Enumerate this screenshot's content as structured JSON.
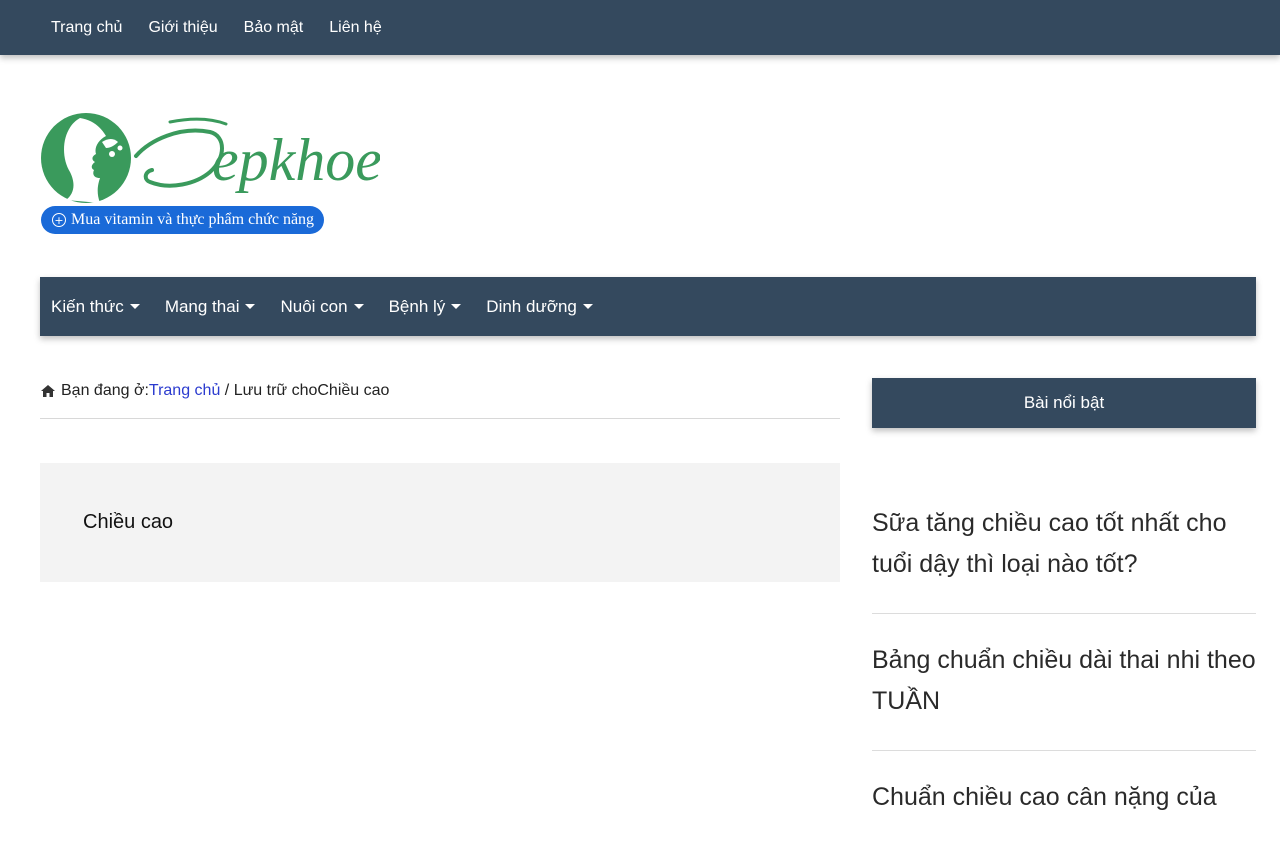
{
  "topnav": {
    "items": [
      "Trang chủ",
      "Giới thiệu",
      "Bảo mật",
      "Liên hệ"
    ]
  },
  "logo": {
    "text": "Đẹpkhoe",
    "buy_button_label": "Mua vitamin và thực phẩm chức năng",
    "brand_color": "#3a9a5c"
  },
  "mainnav": {
    "items": [
      "Kiến thức",
      "Mang thai",
      "Nuôi con",
      "Bệnh lý",
      "Dinh dưỡng"
    ]
  },
  "breadcrumb": {
    "prefix": "Bạn đang ở:",
    "home_link": "Trang chủ",
    "separator": " / ",
    "current": "Lưu trữ choChiều cao"
  },
  "archive": {
    "title": "Chiều cao"
  },
  "sidebar": {
    "title": "Bài nổi bật",
    "posts": [
      "Sữa tăng chiều cao tốt nhất cho tuổi dậy thì loại nào tốt?",
      "Bảng chuẩn chiều dài thai nhi theo TUẦN",
      "Chuẩn chiều cao cân nặng của"
    ]
  },
  "colors": {
    "nav_bg": "#34495e",
    "link": "#2b3bcf",
    "button_blue": "#1a6ad8"
  }
}
